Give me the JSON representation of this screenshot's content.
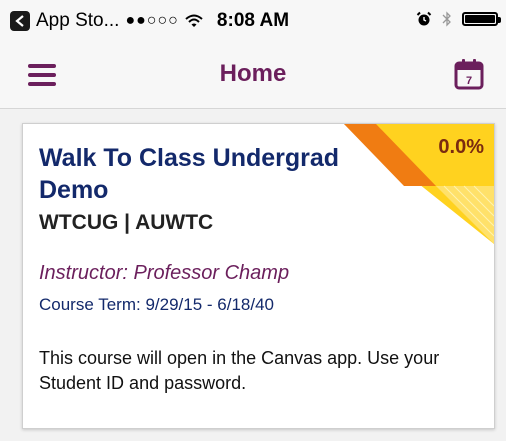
{
  "status_bar": {
    "back_label": "App Sto...",
    "signal": "●●○○○",
    "time": "8:08 AM"
  },
  "header": {
    "title": "Home",
    "menu_icon": "hamburger-menu-icon",
    "calendar_icon": "calendar-icon",
    "calendar_day": "7"
  },
  "course": {
    "name": "Walk To Class Undergrad Demo",
    "code": "WTCUG | AUWTC",
    "instructor": "Instructor: Professor  Champ",
    "term": "Course Term: 9/29/15 - 6/18/40",
    "progress": "0.0%",
    "notice": "This course will open in the Canvas app. Use your Student ID and password."
  },
  "colors": {
    "accent": "#6b1f5c",
    "navy": "#13296b",
    "ribbon_yellow": "#ffd21f",
    "ribbon_orange": "#f07c12"
  }
}
